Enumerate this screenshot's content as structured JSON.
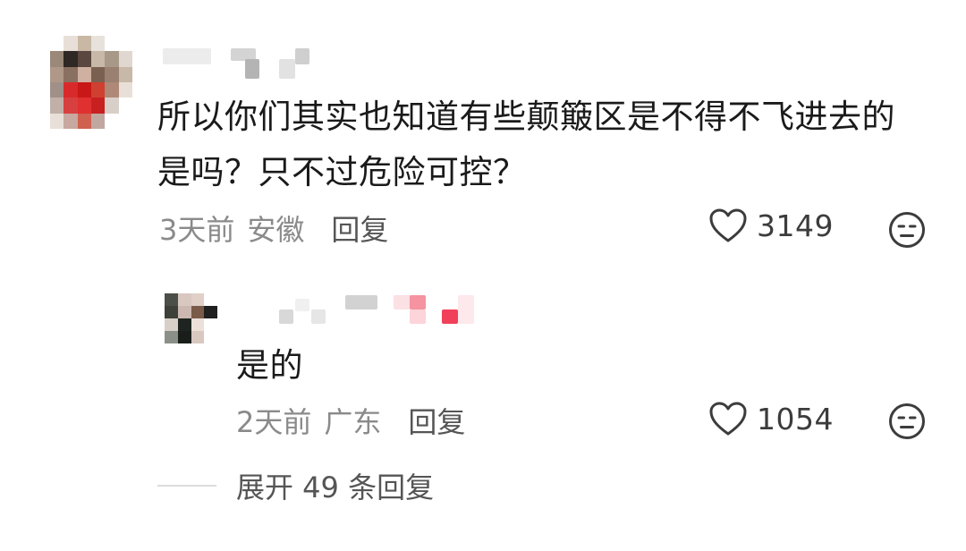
{
  "comment": {
    "text_line1": "所以你们其实也知道有些颠簸区是不得不飞进去的",
    "text_line2": "是吗？只不过危险可控？",
    "time": "3天前",
    "location": "安徽",
    "reply_label": "回复",
    "likes": "3149",
    "like_icon": "heart-outline",
    "dislike_icon": "neutral-face"
  },
  "reply": {
    "text": "是的",
    "time": "2天前",
    "location": "广东",
    "reply_label": "回复",
    "likes": "1054",
    "like_icon": "heart-outline",
    "dislike_icon": "neutral-face"
  },
  "expand": {
    "label": "展开 49 条回复"
  },
  "colors": {
    "text": "#1a1a1a",
    "meta": "#8a8a8a",
    "reply_link": "#555555",
    "icon": "#3c3c3c",
    "blur_pink": "#f07080"
  }
}
